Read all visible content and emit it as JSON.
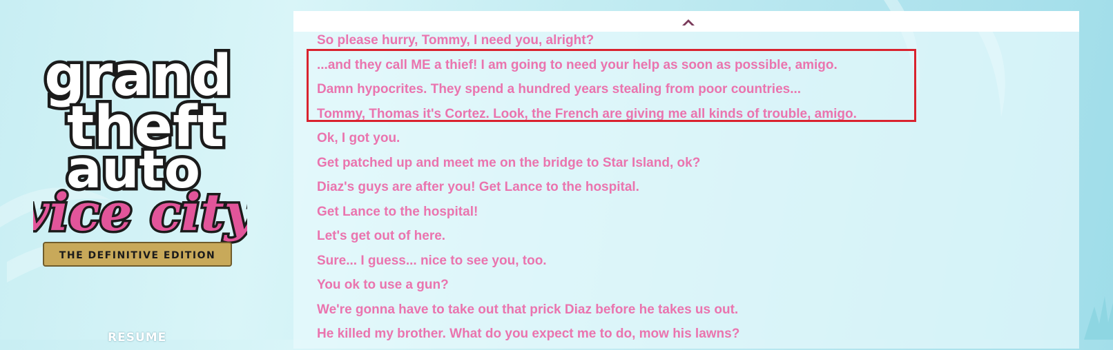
{
  "logo": {
    "line1": "grand",
    "line2": "theft",
    "line3": "auto",
    "line4": "vice city",
    "edition": "THE DEFINITIVE EDITION"
  },
  "sidebar": {
    "resume_label": "RESUME"
  },
  "dialogue": {
    "scroll_up_icon": "chevron-up-icon",
    "lines": [
      "So please hurry, Tommy, I need you, alright?",
      "...and they call ME a thief! I am going to need your help as soon as possible, amigo.",
      "Damn hypocrites. They spend a hundred years stealing from poor countries...",
      "Tommy, Thomas it's Cortez. Look, the French are giving me all kinds of trouble, amigo.",
      "Ok, I got you.",
      "Get patched up and meet me on the bridge to Star Island, ok?",
      "Diaz's guys are after you! Get Lance to the hospital.",
      "Get Lance to the hospital!",
      "Let's get out of here.",
      "Sure... I guess... nice to see you, too.",
      "You ok to use a gun?",
      "We're gonna have to take out that prick Diaz before he takes us out.",
      "He killed my brother. What do you expect me to do, mow his lawns?"
    ]
  },
  "colors": {
    "dialogue_text": "#ea74ae",
    "highlight_border": "#d9222e",
    "header_bg": "#ffffff",
    "chevron": "#7a3a5a"
  }
}
